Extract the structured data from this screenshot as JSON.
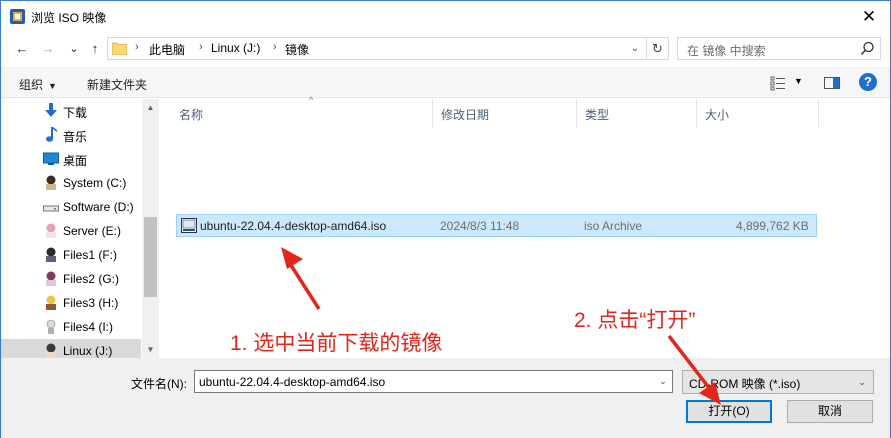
{
  "window": {
    "title": "浏览 ISO 映像",
    "close_glyph": "✕"
  },
  "nav_buttons": {
    "back": "←",
    "forward": "→",
    "recent": "⌄",
    "up": "↑"
  },
  "address": {
    "crumbs": [
      "此电脑",
      "Linux (J:)",
      "镜像"
    ],
    "separator": "›",
    "dropdown_glyph": "⌄",
    "refresh_glyph": "↻"
  },
  "search": {
    "placeholder": "在 镜像 中搜索"
  },
  "toolbar": {
    "organize_label": "组织",
    "organize_caret": "▼",
    "new_folder_label": "新建文件夹",
    "view_caret": "▼",
    "help_label": "?"
  },
  "nav_pane": {
    "items": [
      {
        "label": "下载",
        "icon": "download-icon"
      },
      {
        "label": "音乐",
        "icon": "music-icon"
      },
      {
        "label": "桌面",
        "icon": "desktop-icon"
      },
      {
        "label": "System (C:)",
        "icon": "drive-avatar-icon"
      },
      {
        "label": "Software (D:)",
        "icon": "drive-icon"
      },
      {
        "label": "Server (E:)",
        "icon": "drive-avatar-icon"
      },
      {
        "label": "Files1 (F:)",
        "icon": "drive-avatar-icon"
      },
      {
        "label": "Files2 (G:)",
        "icon": "drive-avatar-icon"
      },
      {
        "label": "Files3 (H:)",
        "icon": "drive-avatar-icon"
      },
      {
        "label": "Files4 (I:)",
        "icon": "drive-avatar-icon"
      },
      {
        "label": "Linux (J:)",
        "icon": "drive-avatar-icon",
        "selected": true
      }
    ],
    "scroll_up": "▲",
    "scroll_down": "▼"
  },
  "file_list": {
    "sort_glyph": "^",
    "columns": {
      "name": "名称",
      "modified": "修改日期",
      "type": "类型",
      "size": "大小"
    },
    "files": [
      {
        "name": "ubuntu-22.04.4-desktop-amd64.iso",
        "modified": "2024/8/3 11:48",
        "type": "iso Archive",
        "size": "4,899,762 KB",
        "icon": "iso-file-icon",
        "selected": true
      }
    ]
  },
  "annotations": {
    "step1": "1. 选中当前下载的镜像",
    "step2": "2. 点击“打开”"
  },
  "bottom": {
    "filename_label": "文件名(N):",
    "filename_value": "ubuntu-22.04.4-desktop-amd64.iso",
    "filter_value": "CD-ROM 映像 (*.iso)",
    "dropdown_caret": "⌄",
    "open_label": "打开(O)",
    "cancel_label": "取消"
  },
  "colors": {
    "accent": "#0078d7",
    "selection": "#cce8ff",
    "annotation": "#e2261c"
  }
}
